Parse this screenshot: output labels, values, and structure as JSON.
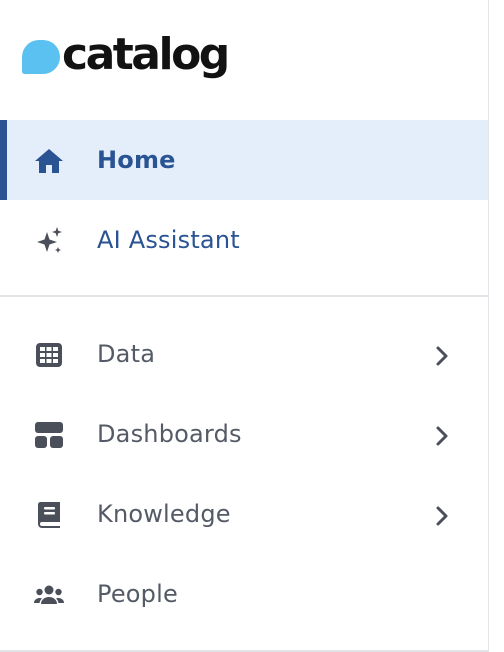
{
  "logo": {
    "text": "catalog",
    "color": "#5bc1f0"
  },
  "nav_primary": [
    {
      "label": "Home",
      "icon": "home-icon",
      "active": true
    },
    {
      "label": "AI Assistant",
      "icon": "sparkle-icon"
    }
  ],
  "nav_secondary": [
    {
      "label": "Data",
      "icon": "table-grid-icon",
      "expandable": true
    },
    {
      "label": "Dashboards",
      "icon": "dashboard-icon",
      "expandable": true
    },
    {
      "label": "Knowledge",
      "icon": "book-icon",
      "expandable": true
    },
    {
      "label": "People",
      "icon": "people-icon",
      "expandable": false
    }
  ],
  "colors": {
    "accent": "#2a5394",
    "active_bg": "#e4eefa",
    "icon": "#4a4f59",
    "text": "#555b66"
  }
}
